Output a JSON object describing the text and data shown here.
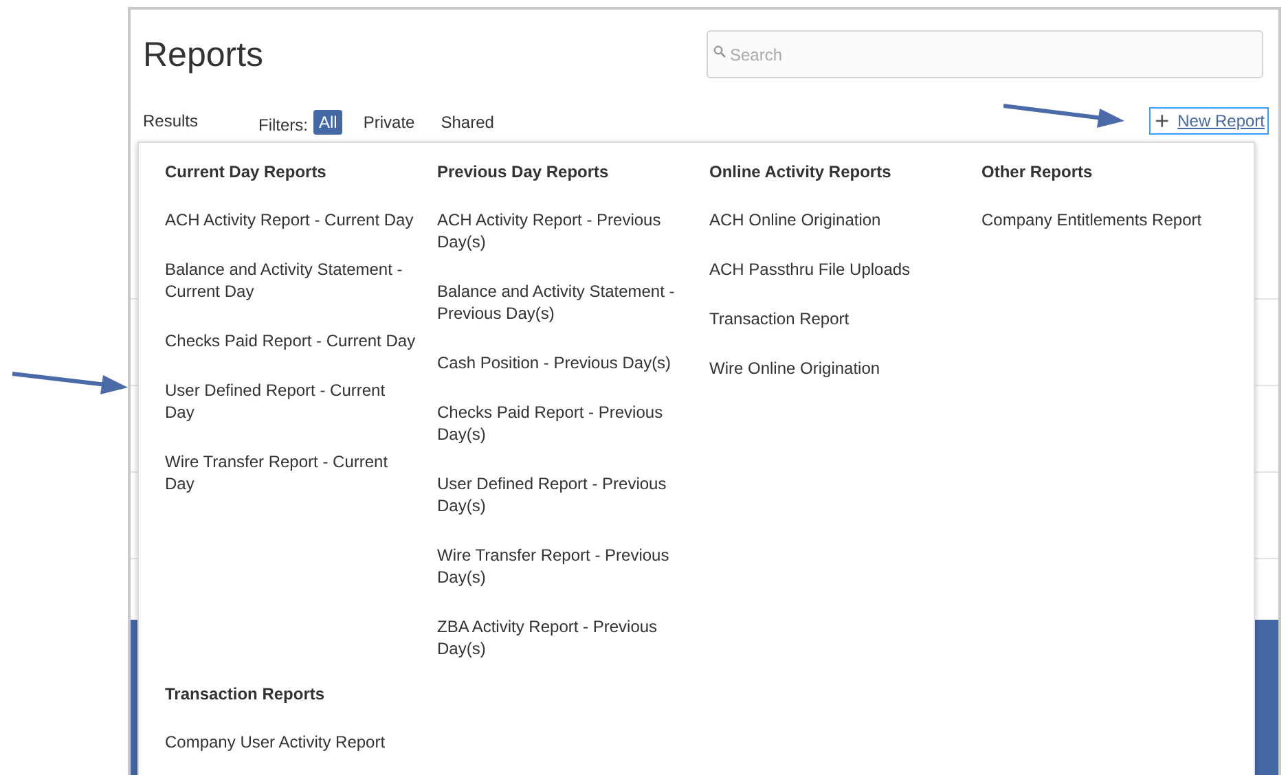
{
  "page": {
    "title": "Reports"
  },
  "search": {
    "placeholder": "Search"
  },
  "toolbar": {
    "results_label": "Results",
    "filters_label": "Filters:",
    "filters": [
      {
        "label": "All",
        "selected": true
      },
      {
        "label": "Private",
        "selected": false
      },
      {
        "label": "Shared",
        "selected": false
      }
    ],
    "new_report": {
      "icon": "+",
      "label": "New Report"
    }
  },
  "menu": {
    "sections": [
      {
        "heading": "Current Day Reports",
        "items": [
          "ACH Activity Report - Current Day",
          "Balance and Activity Statement - Current Day",
          "Checks Paid Report - Current Day",
          "User Defined Report - Current Day",
          "Wire Transfer Report - Current Day"
        ]
      },
      {
        "heading": "Previous Day Reports",
        "items": [
          "ACH Activity Report - Previous Day(s)",
          "Balance and Activity Statement - Previous Day(s)",
          "Cash Position - Previous Day(s)",
          "Checks Paid Report - Previous Day(s)",
          "User Defined Report - Previous Day(s)",
          "Wire Transfer Report - Previous Day(s)",
          "ZBA Activity Report - Previous Day(s)"
        ]
      },
      {
        "heading": "Online Activity Reports",
        "items": [
          "ACH Online Origination",
          "ACH Passthru File Uploads",
          "Transaction Report",
          "Wire Online Origination"
        ]
      },
      {
        "heading": "Other Reports",
        "items": [
          "Company Entitlements Report"
        ]
      },
      {
        "heading": "Transaction Reports",
        "items": [
          "Company User Activity Report"
        ]
      }
    ]
  }
}
